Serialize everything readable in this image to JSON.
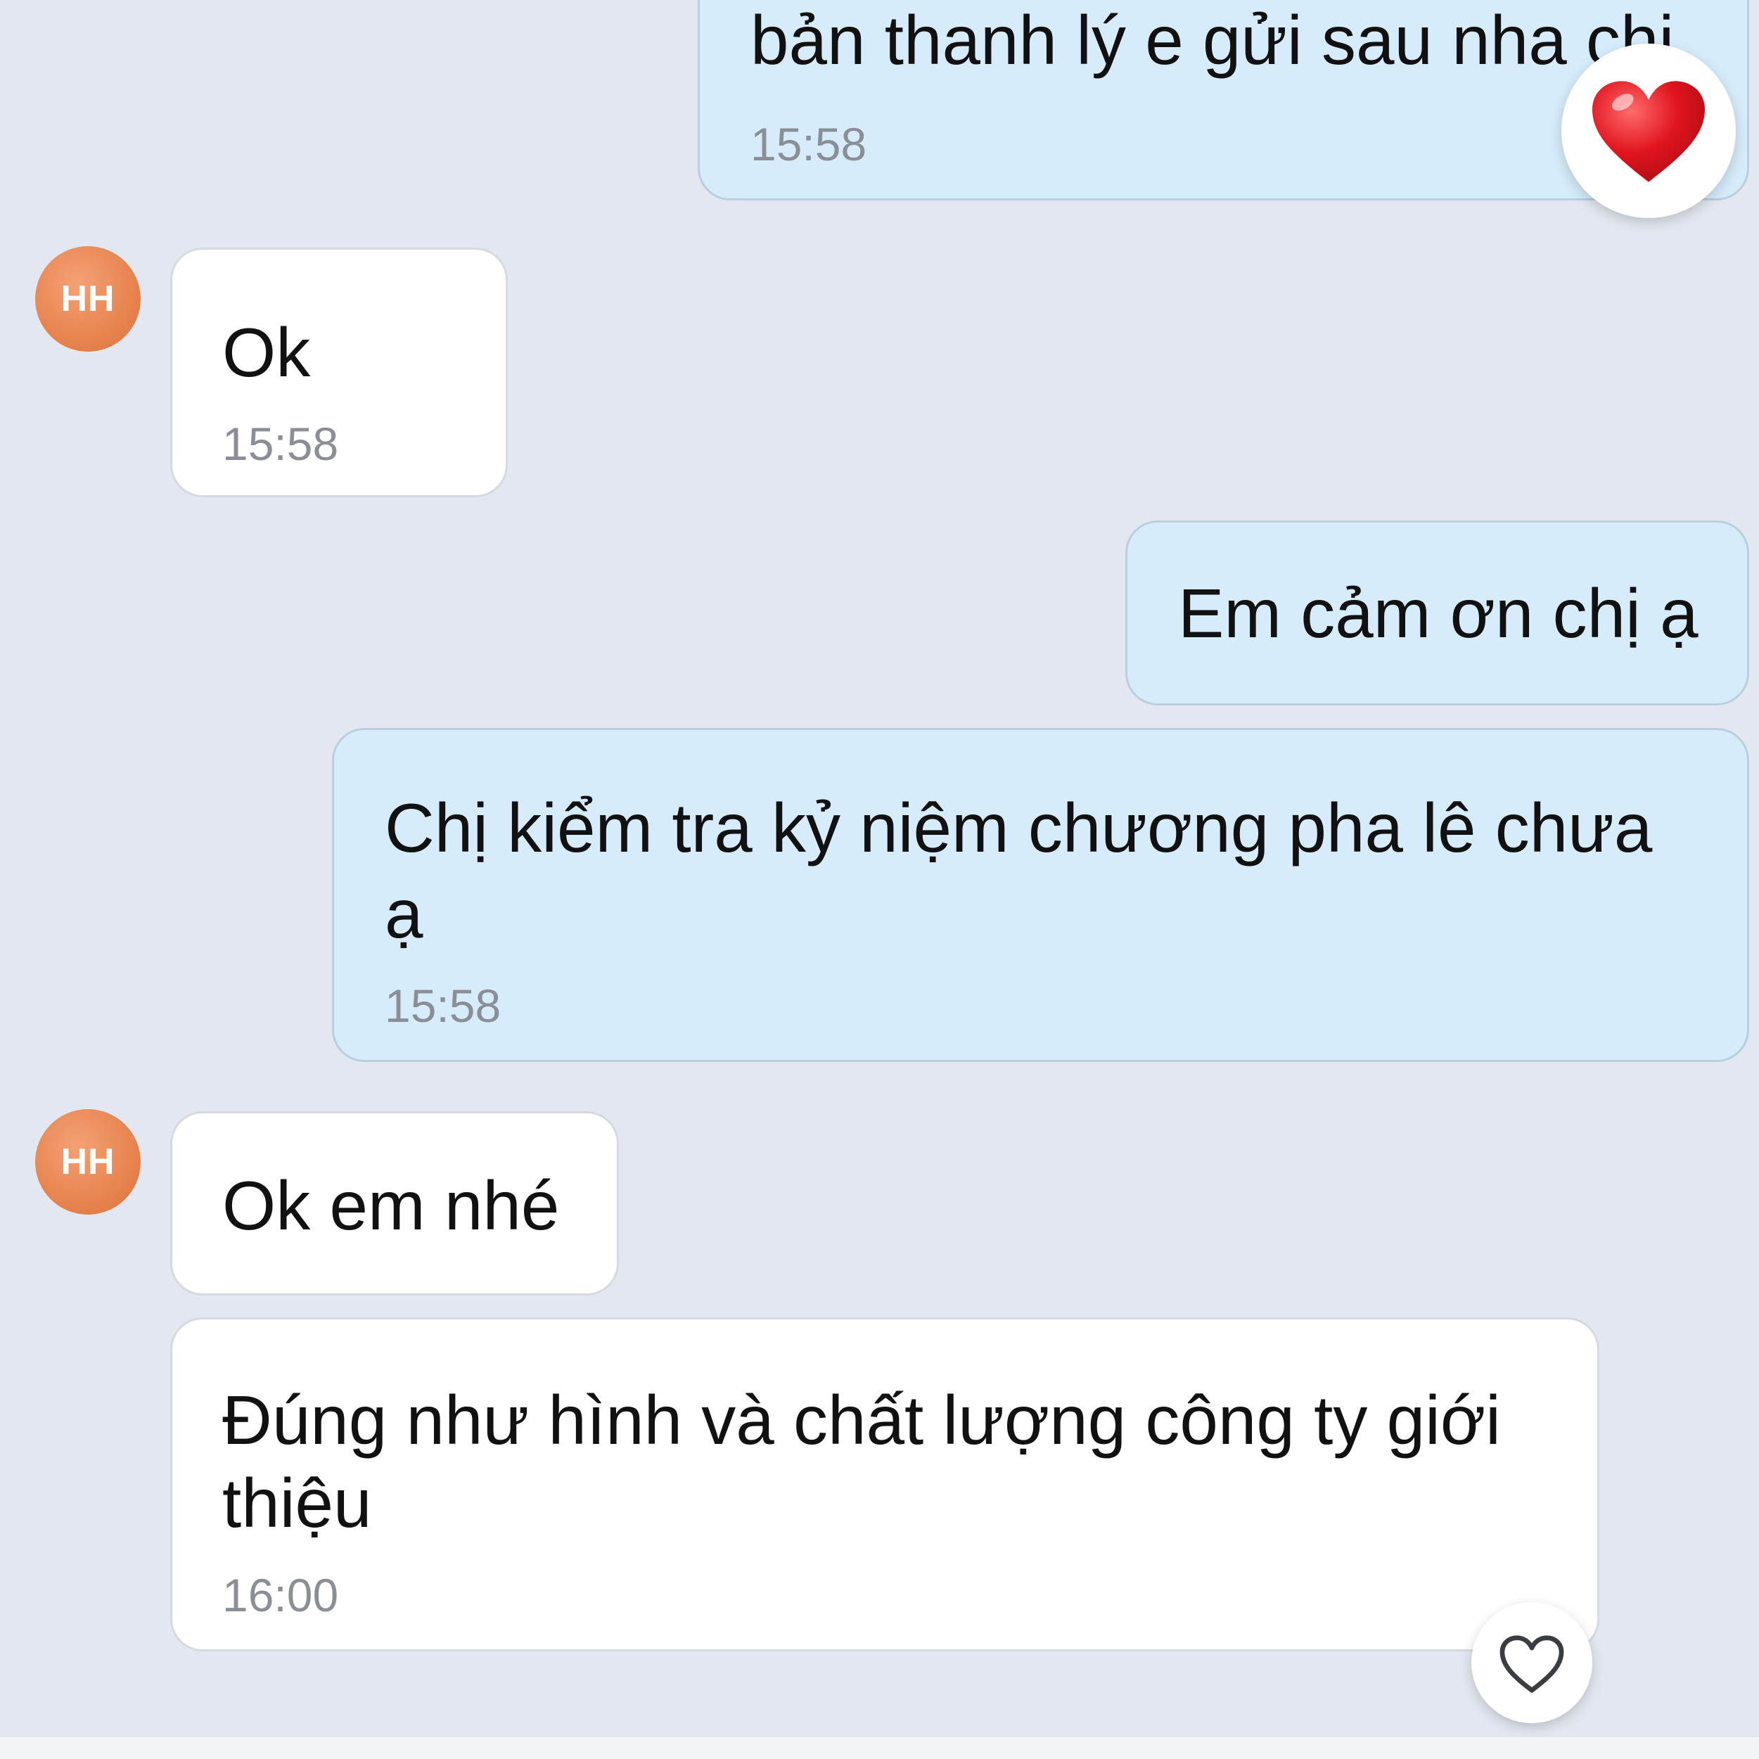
{
  "messages": [
    {
      "direction": "out",
      "lines": [
        "bản thanh lý e gửi sau nha chị"
      ],
      "time": "15:58",
      "reaction": "heart-filled"
    },
    {
      "direction": "in",
      "avatar": "HH",
      "lines": [
        "Ok"
      ],
      "time": "15:58"
    },
    {
      "direction": "out",
      "lines": [
        "Em cảm ơn chị ạ"
      ]
    },
    {
      "direction": "out",
      "lines": [
        "Chị kiểm tra kỷ niệm chương pha lê chưa",
        "ạ"
      ],
      "time": "15:58"
    },
    {
      "direction": "in",
      "avatar": "HH",
      "lines": [
        "Ok em nhé"
      ]
    },
    {
      "direction": "in",
      "lines": [
        "Đúng như hình và chất lượng công ty giới",
        "thiệu"
      ],
      "time": "16:00",
      "reaction": "heart-outline"
    }
  ],
  "colors": {
    "background": "#e3e8f0",
    "outgoing_bubble": "#d6ecfb",
    "incoming_bubble": "#ffffff",
    "avatar": "#e7844f",
    "heart": "#e0141e",
    "timestamp": "#8a8f97"
  }
}
